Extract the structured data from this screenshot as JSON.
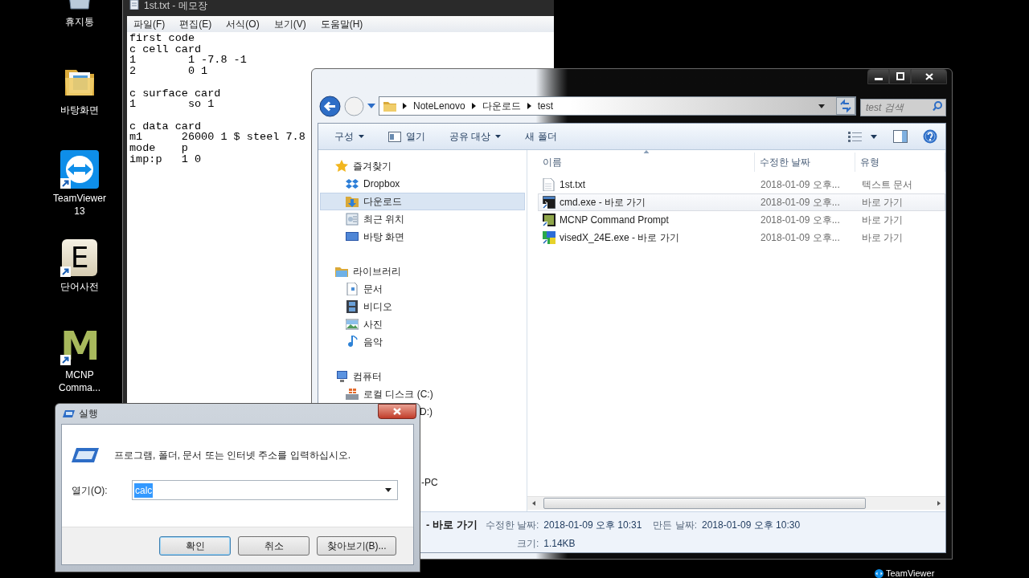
{
  "desktop": {
    "icons": [
      {
        "label": "휴지통",
        "kind": "bin",
        "shortcut": false
      },
      {
        "label": "바탕화면",
        "kind": "folder",
        "shortcut": false
      },
      {
        "label": "TeamViewer 13",
        "kind": "teamviewer",
        "shortcut": true
      },
      {
        "label": "단어사전",
        "kind": "dictionary",
        "glyph": "E",
        "shortcut": true
      },
      {
        "label": "MCNP Comma...",
        "kind": "mcnp",
        "glyph": "M",
        "shortcut": true
      }
    ]
  },
  "notepad": {
    "title": "1st.txt - 메모장",
    "menu": [
      "파일(F)",
      "편집(E)",
      "서식(O)",
      "보기(V)",
      "도움말(H)"
    ],
    "text": "first code\nc cell card\n1\t 1 -7.8 -1\n2\t 0 1\n\nc surface card\n1\t so 1\n\nc data card\nm1\t26000 1 $ steel 7.8\nmode\tp\nimp:p\t1 0"
  },
  "explorer": {
    "address": [
      "NoteLenovo",
      "다운로드",
      "test"
    ],
    "search": {
      "placeholder": "test 검색"
    },
    "toolbar": [
      {
        "label": "구성",
        "kind": "menu"
      },
      {
        "label": "열기",
        "kind": "open"
      },
      {
        "label": "공유 대상",
        "kind": "menu"
      },
      {
        "label": "새 폴더",
        "kind": "plain"
      }
    ],
    "nav": [
      {
        "label": "즐겨찾기",
        "kind": "star",
        "selected": false,
        "children": [
          {
            "label": "Dropbox",
            "kind": "dropbox",
            "selected": false
          },
          {
            "label": "다운로드",
            "kind": "downloads",
            "selected": true
          },
          {
            "label": "최근 위치",
            "kind": "recent",
            "selected": false
          },
          {
            "label": "바탕 화면",
            "kind": "desktop",
            "selected": false
          }
        ]
      },
      {
        "label": "라이브러리",
        "kind": "library",
        "selected": false,
        "children": [
          {
            "label": "문서",
            "kind": "document",
            "selected": false
          },
          {
            "label": "비디오",
            "kind": "video",
            "selected": false
          },
          {
            "label": "사진",
            "kind": "photo",
            "selected": false
          },
          {
            "label": "음악",
            "kind": "music",
            "selected": false
          }
        ]
      },
      {
        "label": "컴퓨터",
        "kind": "computer",
        "selected": false,
        "children": [
          {
            "label": "로컬 디스크 (C:)",
            "kind": "disk",
            "selected": false
          },
          {
            "label": "D:)",
            "kind": "cut",
            "selected": false
          }
        ]
      },
      {
        "label": "-PC",
        "kind": "cut",
        "selected": false
      }
    ],
    "columns": [
      {
        "label": "이름",
        "sorted": true
      },
      {
        "label": "수정한 날짜",
        "sorted": false
      },
      {
        "label": "유형",
        "sorted": false
      }
    ],
    "rows": [
      {
        "name": "1st.txt",
        "date": "2018-01-09 오후...",
        "type": "텍스트 문서",
        "kind": "text",
        "selected": false
      },
      {
        "name": "cmd.exe - 바로 가기",
        "date": "2018-01-09 오후...",
        "type": "바로 가기",
        "kind": "cmd",
        "selected": true
      },
      {
        "name": "MCNP Command Prompt",
        "date": "2018-01-09 오후...",
        "type": "바로 가기",
        "kind": "mcnp",
        "selected": false
      },
      {
        "name": "visedX_24E.exe - 바로 가기",
        "date": "2018-01-09 오후...",
        "type": "바로 가기",
        "kind": "visedx",
        "selected": false
      }
    ],
    "details": {
      "name": "- 바로 가기",
      "modified_label": "수정한 날짜:",
      "modified": "2018-01-09 오후 10:31",
      "created_label": "만든 날짜:",
      "created": "2018-01-09 오후 10:30",
      "size_label": "크기:",
      "size": "1.14KB"
    }
  },
  "run": {
    "title": "실행",
    "prompt": "프로그램, 폴더, 문서 또는 인터넷 주소를 입력하십시오.",
    "open_label": "열기(O):",
    "value": "calc",
    "value_selected": true,
    "buttons": [
      {
        "label": "확인",
        "default": true
      },
      {
        "label": "취소",
        "default": false
      },
      {
        "label": "찾아보기(B)...",
        "default": false
      }
    ]
  },
  "teamviewer_badge": {
    "label": "TeamViewer"
  }
}
